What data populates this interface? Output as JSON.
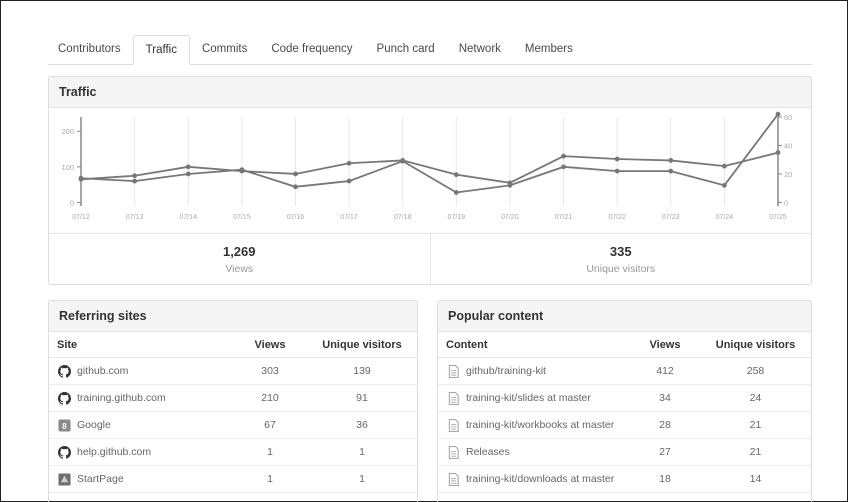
{
  "tabs": [
    {
      "label": "Contributors",
      "active": false
    },
    {
      "label": "Traffic",
      "active": true
    },
    {
      "label": "Commits",
      "active": false
    },
    {
      "label": "Code frequency",
      "active": false
    },
    {
      "label": "Punch card",
      "active": false
    },
    {
      "label": "Network",
      "active": false
    },
    {
      "label": "Members",
      "active": false
    }
  ],
  "traffic": {
    "title": "Traffic",
    "views_total": "1,269",
    "views_label": "Views",
    "uniques_total": "335",
    "uniques_label": "Unique visitors"
  },
  "chart_data": {
    "type": "line",
    "x": [
      "07/12",
      "07/13",
      "07/14",
      "07/15",
      "07/16",
      "07/17",
      "07/18",
      "07/19",
      "07/20",
      "07/21",
      "07/22",
      "07/23",
      "07/24",
      "07/25"
    ],
    "series": [
      {
        "axis": "left",
        "values": [
          65,
          75,
          100,
          88,
          80,
          110,
          118,
          78,
          55,
          130,
          122,
          118,
          102,
          140
        ]
      },
      {
        "axis": "right",
        "values": [
          17,
          15,
          20,
          23,
          11,
          15,
          29,
          7,
          12,
          25,
          22,
          22,
          12,
          62
        ]
      }
    ],
    "y_left": {
      "ticks": [
        0,
        100,
        200
      ],
      "range": [
        -10,
        240
      ]
    },
    "y_right": {
      "ticks": [
        0,
        20,
        40,
        60
      ],
      "range": [
        -2.5,
        60
      ]
    },
    "grid": "vertical",
    "colors": {
      "line": "#777777",
      "axis": "#888888",
      "grid": "#e8e8e8",
      "tick_text": "#aaaaaa"
    }
  },
  "referring": {
    "title": "Referring sites",
    "columns": [
      "Site",
      "Views",
      "Unique visitors"
    ],
    "rows": [
      {
        "icon": "github-icon",
        "name": "github.com",
        "views": "303",
        "uniques": "139"
      },
      {
        "icon": "github-icon",
        "name": "training.github.com",
        "views": "210",
        "uniques": "91"
      },
      {
        "icon": "google-icon",
        "name": "Google",
        "views": "67",
        "uniques": "36"
      },
      {
        "icon": "github-icon",
        "name": "help.github.com",
        "views": "1",
        "uniques": "1"
      },
      {
        "icon": "startpage-icon",
        "name": "StartPage",
        "views": "1",
        "uniques": "1"
      }
    ]
  },
  "popular": {
    "title": "Popular content",
    "columns": [
      "Content",
      "Views",
      "Unique visitors"
    ],
    "rows": [
      {
        "icon": "file-icon",
        "name": "github/training-kit",
        "views": "412",
        "uniques": "258"
      },
      {
        "icon": "file-icon",
        "name": "training-kit/slides at master",
        "views": "34",
        "uniques": "24"
      },
      {
        "icon": "file-icon",
        "name": "training-kit/workbooks at master",
        "views": "28",
        "uniques": "21"
      },
      {
        "icon": "file-icon",
        "name": "Releases",
        "views": "27",
        "uniques": "21"
      },
      {
        "icon": "file-icon",
        "name": "training-kit/downloads at master",
        "views": "18",
        "uniques": "14"
      }
    ]
  }
}
